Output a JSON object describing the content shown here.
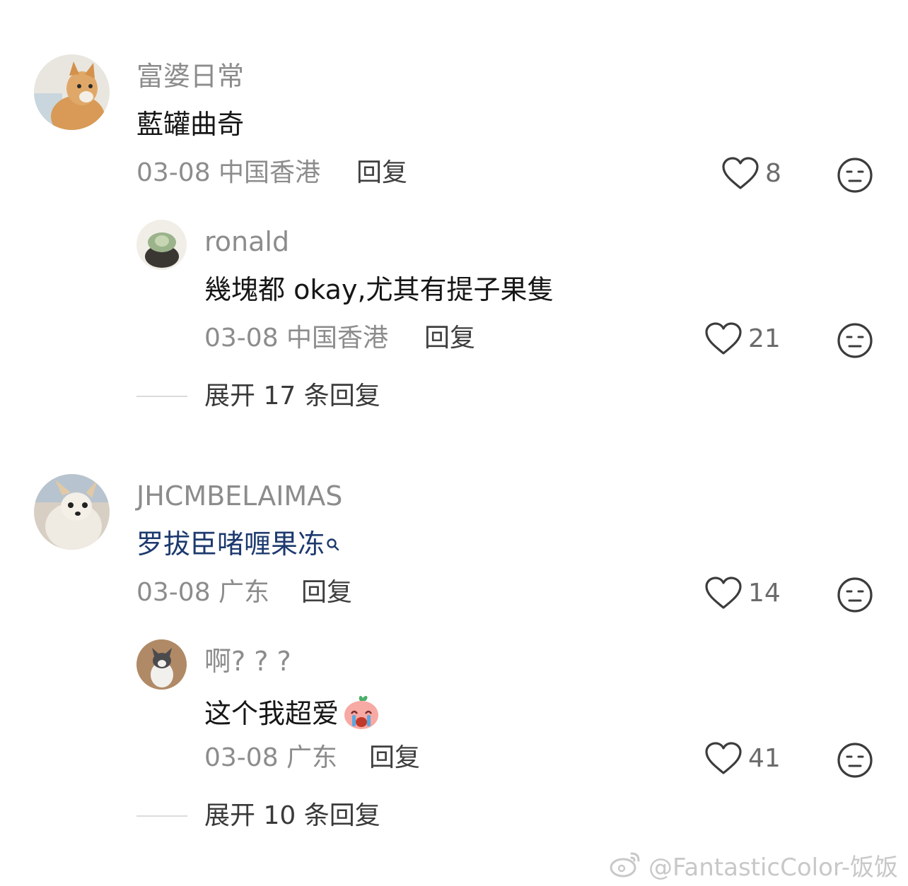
{
  "comments": [
    {
      "user": "富婆日常",
      "text": "藍罐曲奇",
      "date_location": "03-08 中国香港",
      "reply_label": "回复",
      "likes": "8",
      "replies": [
        {
          "user": "ronald",
          "text": "幾塊都 okay,尤其有提子果隻",
          "date_location": "03-08 中国香港",
          "reply_label": "回复",
          "likes": "21"
        }
      ],
      "expand_label": "展开 17 条回复"
    },
    {
      "user": "JHCMBELAIMAS",
      "text": "罗拔臣啫喱果冻",
      "date_location": "03-08 广东",
      "reply_label": "回复",
      "likes": "14",
      "replies": [
        {
          "user": "啊? ? ?",
          "text": "这个我超爱",
          "date_location": "03-08 广东",
          "reply_label": "回复",
          "likes": "41"
        }
      ],
      "expand_label": "展开 10 条回复"
    }
  ],
  "watermark": "@FantasticColor-饭饭",
  "icons": {
    "like": "heart-outline-icon",
    "react": "neutral-face-icon",
    "search": "search-icon",
    "watermark": "weibo-logo-icon",
    "emoji": "crying-emoji-icon"
  }
}
